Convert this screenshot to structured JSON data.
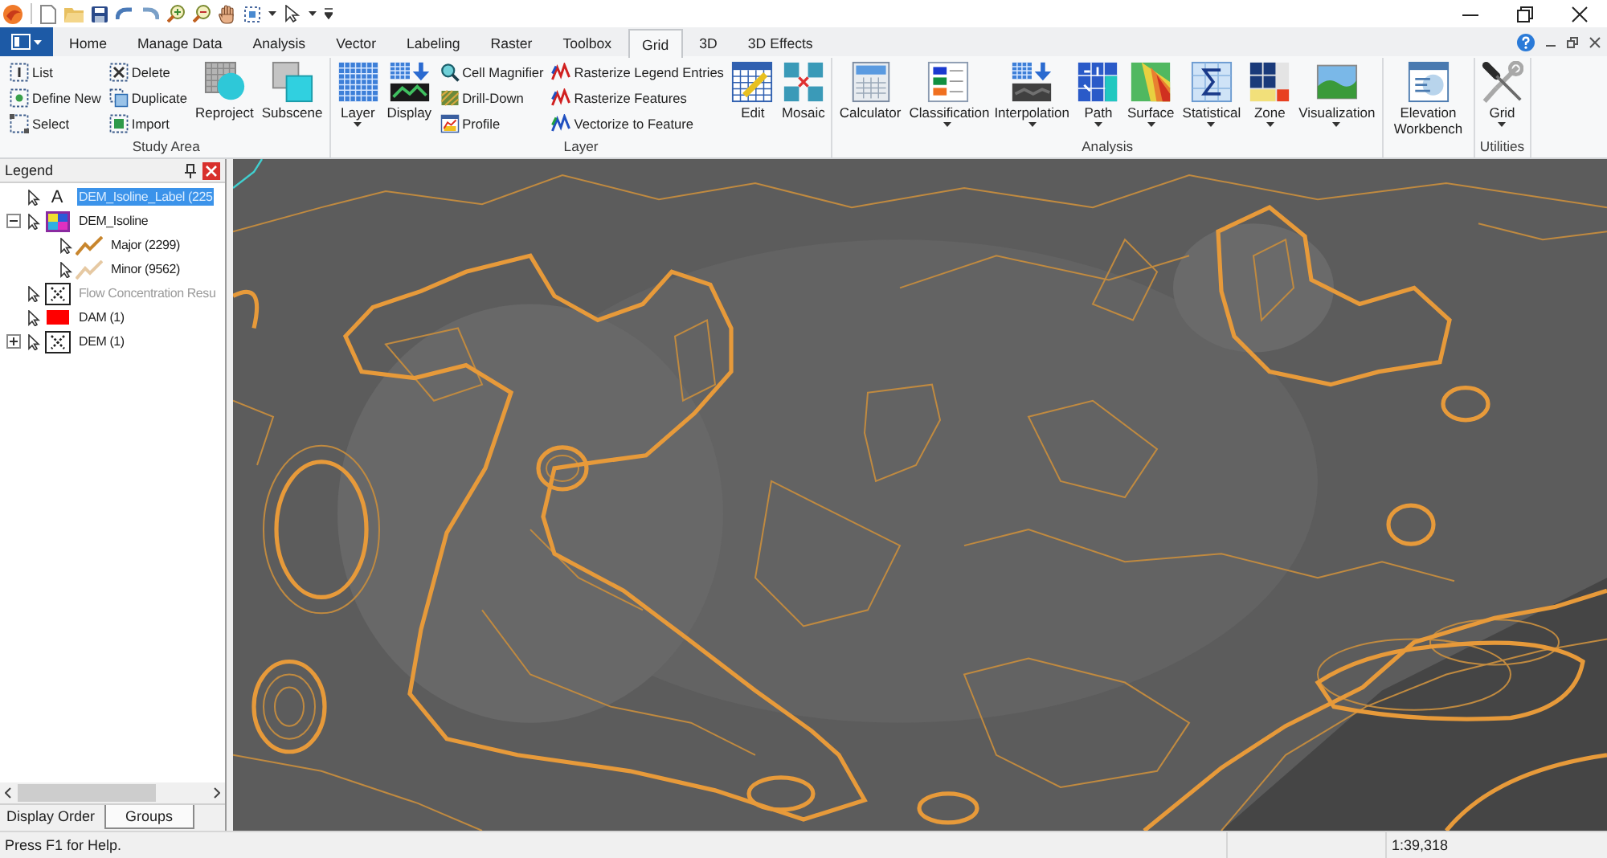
{
  "tabs": [
    {
      "label": "Home",
      "selected": false
    },
    {
      "label": "Manage Data",
      "selected": false
    },
    {
      "label": "Analysis",
      "selected": false
    },
    {
      "label": "Vector",
      "selected": false
    },
    {
      "label": "Labeling",
      "selected": false
    },
    {
      "label": "Raster",
      "selected": false
    },
    {
      "label": "Toolbox",
      "selected": false
    },
    {
      "label": "Grid",
      "selected": true
    },
    {
      "label": "3D",
      "selected": false
    },
    {
      "label": "3D Effects",
      "selected": false
    }
  ],
  "ribbon": {
    "groups": [
      {
        "label": "Study Area",
        "items": [
          {
            "kind": "stack",
            "buttons": [
              {
                "label": "List"
              },
              {
                "label": "Define New"
              },
              {
                "label": "Select"
              }
            ]
          },
          {
            "kind": "stack",
            "buttons": [
              {
                "label": "Delete"
              },
              {
                "label": "Duplicate"
              },
              {
                "label": "Import"
              }
            ]
          },
          {
            "kind": "large",
            "label": "Reproject",
            "dropdown": false
          },
          {
            "kind": "large",
            "label": "Subscene",
            "dropdown": false
          }
        ]
      },
      {
        "label": "Layer",
        "items": [
          {
            "kind": "large",
            "label": "Layer",
            "dropdown": true
          },
          {
            "kind": "large",
            "label": "Display",
            "dropdown": false
          },
          {
            "kind": "stack",
            "buttons": [
              {
                "label": "Cell Magnifier"
              },
              {
                "label": "Drill-Down"
              },
              {
                "label": "Profile"
              }
            ]
          },
          {
            "kind": "stack",
            "buttons": [
              {
                "label": "Rasterize Legend Entries"
              },
              {
                "label": "Rasterize Features"
              },
              {
                "label": "Vectorize to Feature"
              }
            ]
          },
          {
            "kind": "large",
            "label": "Edit",
            "dropdown": false
          },
          {
            "kind": "large",
            "label": "Mosaic",
            "dropdown": false
          }
        ]
      },
      {
        "label": "Analysis",
        "items": [
          {
            "kind": "large",
            "label": "Calculator",
            "dropdown": false
          },
          {
            "kind": "large",
            "label": "Classification",
            "dropdown": true
          },
          {
            "kind": "large",
            "label": "Interpolation",
            "dropdown": true
          },
          {
            "kind": "large",
            "label": "Path",
            "dropdown": true
          },
          {
            "kind": "large",
            "label": "Surface",
            "dropdown": true
          },
          {
            "kind": "large",
            "label": "Statistical",
            "dropdown": true
          },
          {
            "kind": "large",
            "label": "Zone",
            "dropdown": true
          },
          {
            "kind": "large",
            "label": "Visualization",
            "dropdown": true
          }
        ]
      },
      {
        "items": [
          {
            "kind": "large",
            "label": "Elevation Workbench",
            "dropdown": false
          }
        ]
      },
      {
        "label": "Utilities",
        "items": [
          {
            "kind": "large",
            "label": "Grid",
            "dropdown": true
          }
        ]
      }
    ]
  },
  "legend": {
    "title": "Legend",
    "items": [
      {
        "kind": "label",
        "symbol": "A",
        "label": "DEM_Isoline_Label (225",
        "selected": true,
        "disabled": false
      },
      {
        "kind": "theme",
        "label": "DEM_Isoline",
        "expanded": true,
        "selected": false,
        "disabled": false,
        "children": [
          {
            "kind": "line",
            "label": "Major (2299)",
            "color": "#c8862e",
            "selected": false,
            "disabled": false
          },
          {
            "kind": "line",
            "label": "Minor (9562)",
            "color": "#e6c9a3",
            "selected": false,
            "disabled": false
          }
        ]
      },
      {
        "kind": "raster",
        "label": "Flow Concentration Resu",
        "selected": false,
        "disabled": true
      },
      {
        "kind": "fill",
        "label": "DAM (1)",
        "color": "#ff0000",
        "selected": false,
        "disabled": false
      },
      {
        "kind": "raster",
        "label": "DEM (1)",
        "expanded": false,
        "selected": false,
        "disabled": false
      }
    ],
    "tabs": [
      {
        "label": "Display Order",
        "selected": true
      },
      {
        "label": "Groups",
        "selected": false
      }
    ]
  },
  "status_bar": {
    "help": "Press F1 for Help.",
    "scale": "1:39,318"
  }
}
